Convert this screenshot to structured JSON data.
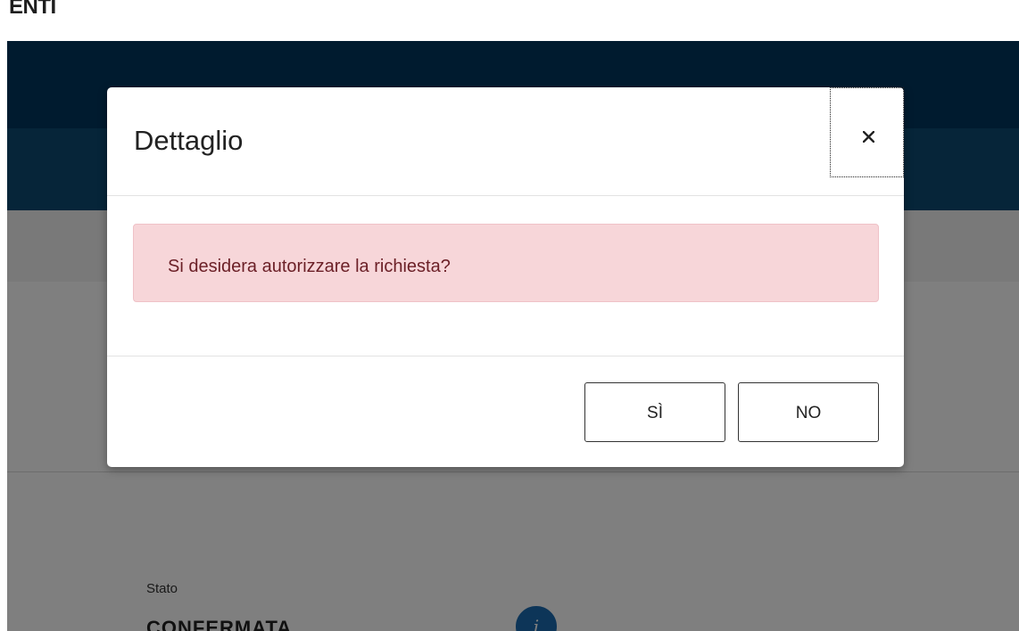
{
  "app": {
    "topbar_label": "ENTI"
  },
  "background": {
    "status_label": "Stato",
    "status_value": "CONFERMATA",
    "info_icon": "info-icon"
  },
  "modal": {
    "title": "Dettaglio",
    "close_label": "×",
    "close_icon": "close-icon",
    "message": "Si desidera autorizzare la richiesta?",
    "buttons": {
      "yes_label": "SÌ",
      "no_label": "NO"
    }
  },
  "colors": {
    "header_dark": "#01375f",
    "header_mid": "#0d4a72",
    "alert_background": "#f7d6d9",
    "alert_text": "#6b1f26",
    "info_accent": "#1a6bb0"
  }
}
